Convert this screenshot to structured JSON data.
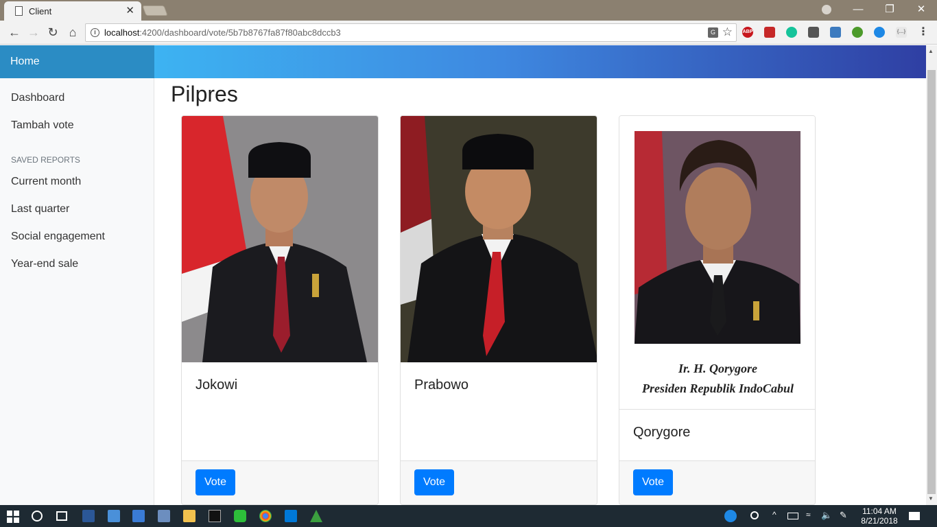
{
  "browser": {
    "tab_title": "Client",
    "tab_close": "✕",
    "url_host": "localhost",
    "url_path": ":4200/dashboard/vote/5b7b8767fa87f80abc8dccb3",
    "extensions": [
      "ABP"
    ]
  },
  "window": {
    "minimize": "—",
    "restore": "❐",
    "close": "✕"
  },
  "app": {
    "brand": "Home"
  },
  "sidebar": {
    "items": [
      {
        "label": "Dashboard"
      },
      {
        "label": "Tambah vote"
      }
    ],
    "section_title": "SAVED REPORTS",
    "reports": [
      {
        "label": "Current month"
      },
      {
        "label": "Last quarter"
      },
      {
        "label": "Social engagement"
      },
      {
        "label": "Year-end sale"
      }
    ]
  },
  "main": {
    "title": "Pilpres",
    "candidates": [
      {
        "name": "Jokowi",
        "button": "Vote"
      },
      {
        "name": "Prabowo",
        "button": "Vote"
      },
      {
        "name": "Qorygore",
        "button": "Vote",
        "caption_line1": "Ir. H. Qorygore",
        "caption_line2": "Presiden Republik IndoCabul"
      }
    ]
  },
  "taskbar": {
    "time": "11:04 AM",
    "date": "8/21/2018"
  },
  "colors": {
    "accent": "#007bff",
    "brand": "#2b8cc4"
  }
}
